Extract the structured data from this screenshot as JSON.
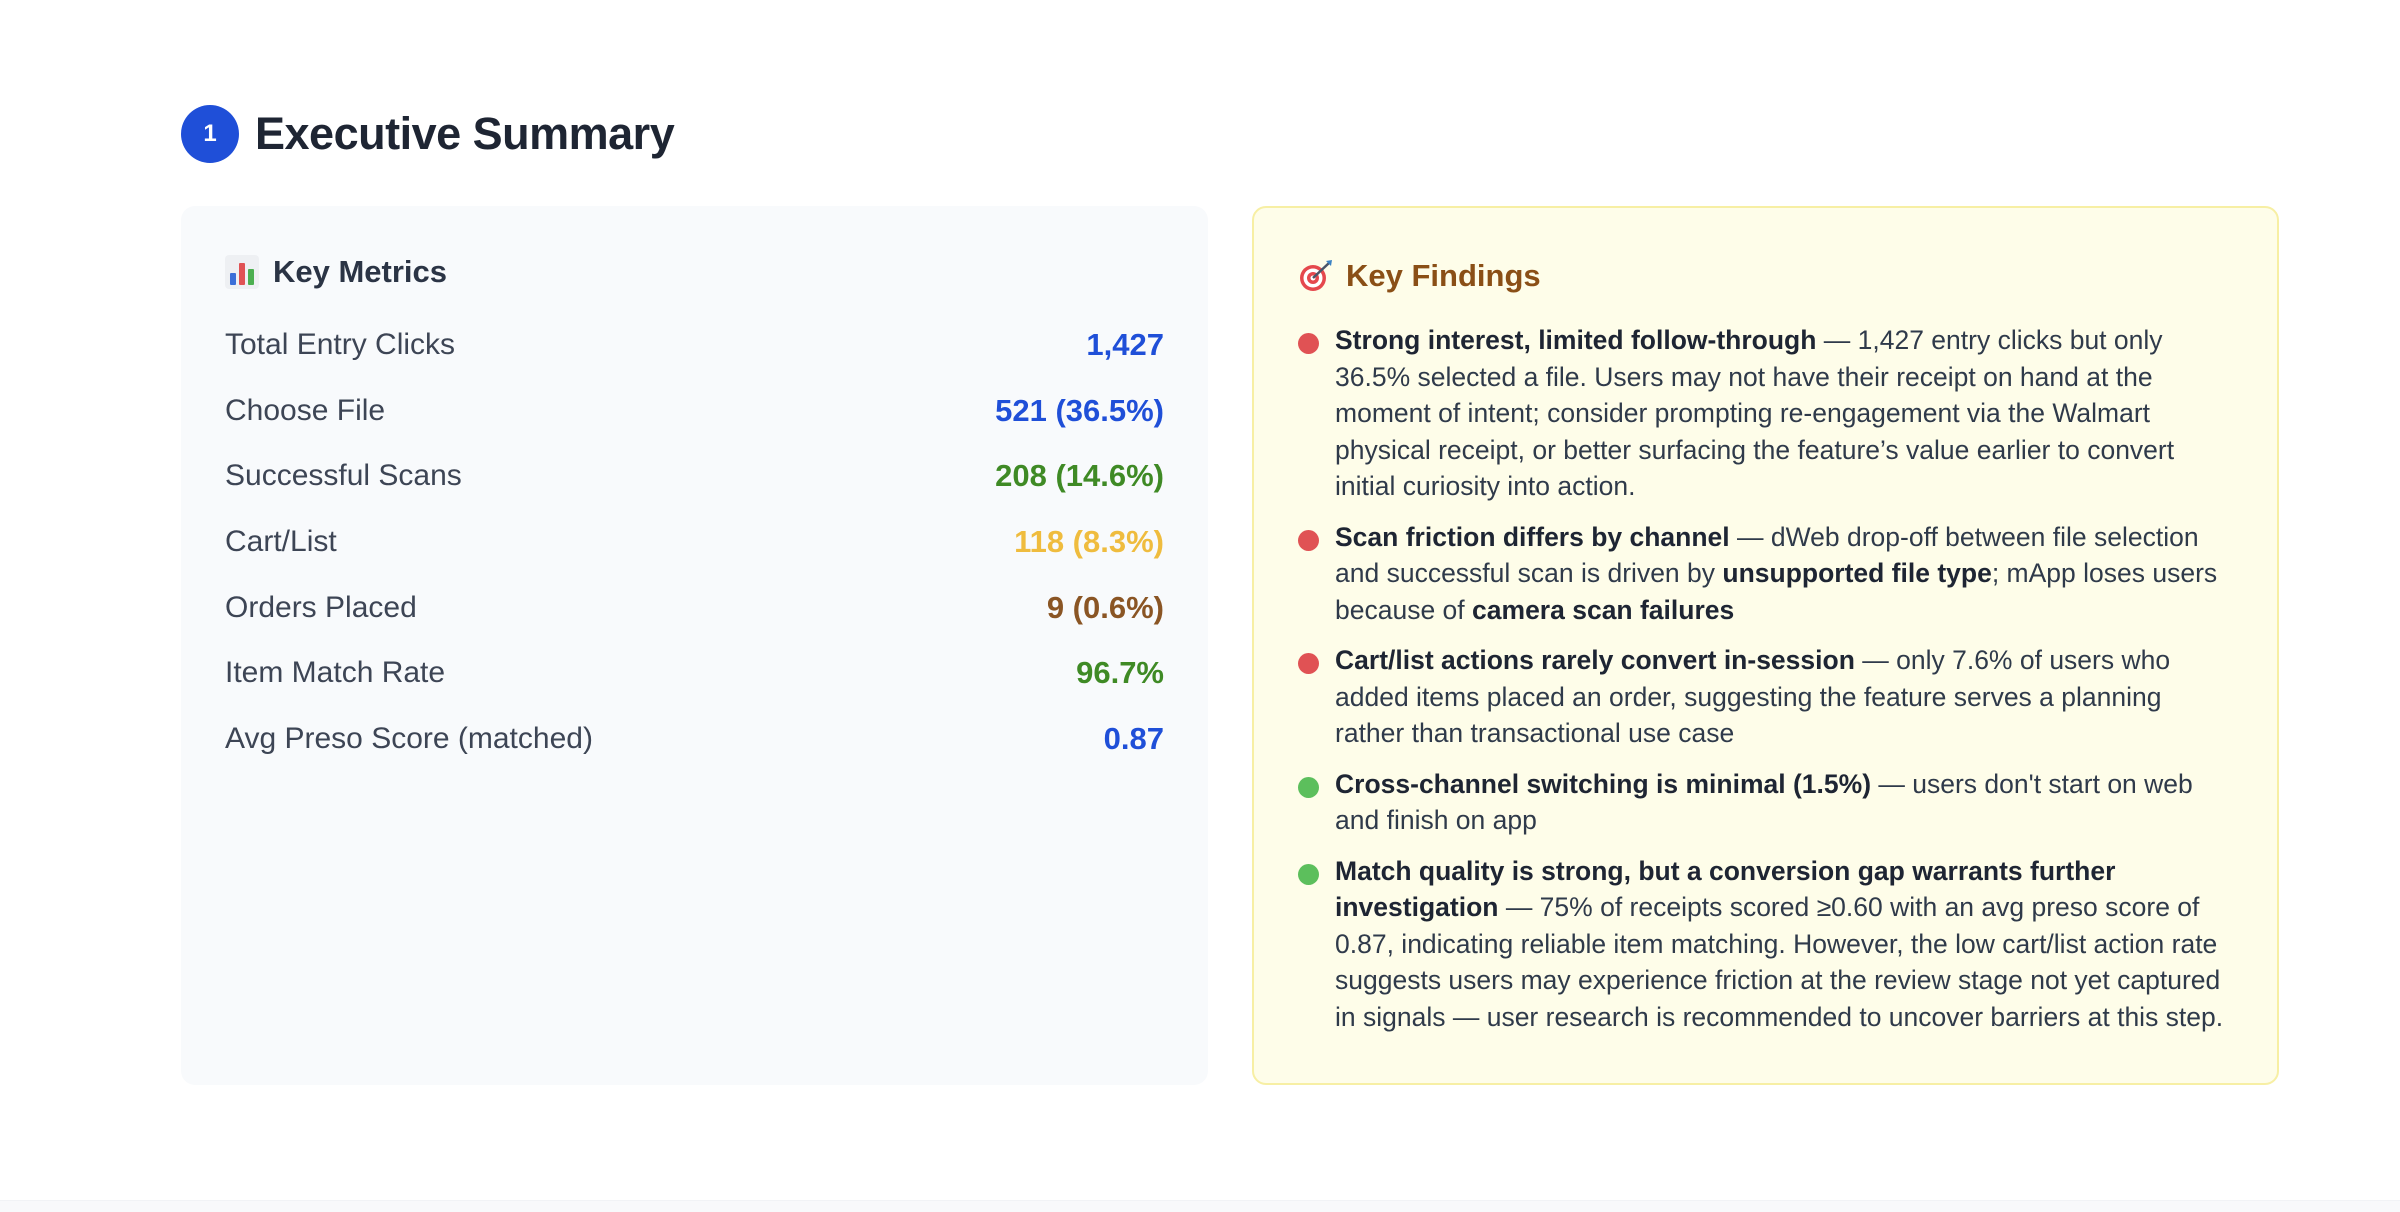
{
  "section": {
    "number": "1",
    "title": "Executive Summary"
  },
  "metrics": {
    "title": "Key Metrics",
    "icon": "bar-chart-icon",
    "rows": [
      {
        "label": "Total Entry Clicks",
        "value": "1,427",
        "color": "#1f4fd8"
      },
      {
        "label": "Choose File",
        "value": "521 (36.5%)",
        "color": "#1f4fd8"
      },
      {
        "label": "Successful Scans",
        "value": "208 (14.6%)",
        "color": "#3f8a25"
      },
      {
        "label": "Cart/List",
        "value": "118 (8.3%)",
        "color": "#efbc3e"
      },
      {
        "label": "Orders Placed",
        "value": "9 (0.6%)",
        "color": "#8a5524"
      },
      {
        "label": "Item Match Rate",
        "value": "96.7%",
        "color": "#3f8a25"
      },
      {
        "label": "Avg Preso Score (matched)",
        "value": "0.87",
        "color": "#1f4fd8"
      }
    ]
  },
  "findings": {
    "title": "Key Findings",
    "icon": "target-icon",
    "colors": {
      "red": "#e05254",
      "green": "#5cbf5c"
    },
    "items": [
      {
        "dot": "red",
        "parts": [
          {
            "t": "Strong interest, limited follow-through",
            "b": true
          },
          {
            "t": " — 1,427 entry clicks but only 36.5% selected a file. Users may not have their receipt on hand at the moment of intent; consider prompting re-engagement via the Walmart physical receipt, or better surfacing the feature’s value earlier to convert initial curiosity into action.",
            "b": false
          }
        ]
      },
      {
        "dot": "red",
        "parts": [
          {
            "t": "Scan friction differs by channel",
            "b": true
          },
          {
            "t": " — dWeb drop-off between file selection and successful scan is driven by ",
            "b": false
          },
          {
            "t": "unsupported file type",
            "b": true
          },
          {
            "t": "; mApp loses users because of ",
            "b": false
          },
          {
            "t": "camera scan failures",
            "b": true
          }
        ]
      },
      {
        "dot": "red",
        "parts": [
          {
            "t": "Cart/list actions rarely convert in-session",
            "b": true
          },
          {
            "t": " — only 7.6% of users who added items placed an order, suggesting the feature serves a planning rather than transactional use case",
            "b": false
          }
        ]
      },
      {
        "dot": "green",
        "parts": [
          {
            "t": "Cross-channel switching is minimal (1.5%)",
            "b": true
          },
          {
            "t": " — users don't start on web and finish on app",
            "b": false
          }
        ]
      },
      {
        "dot": "green",
        "parts": [
          {
            "t": "Match quality is strong, but a conversion gap warrants further investigation",
            "b": true
          },
          {
            "t": " — 75% of receipts scored ≥0.60 with an avg preso score of 0.87, indicating reliable item matching. However, the low cart/list action rate suggests users may experience friction at the review stage not yet captured in signals — user research is recommended to uncover barriers at this step.",
            "b": false
          }
        ]
      }
    ]
  }
}
